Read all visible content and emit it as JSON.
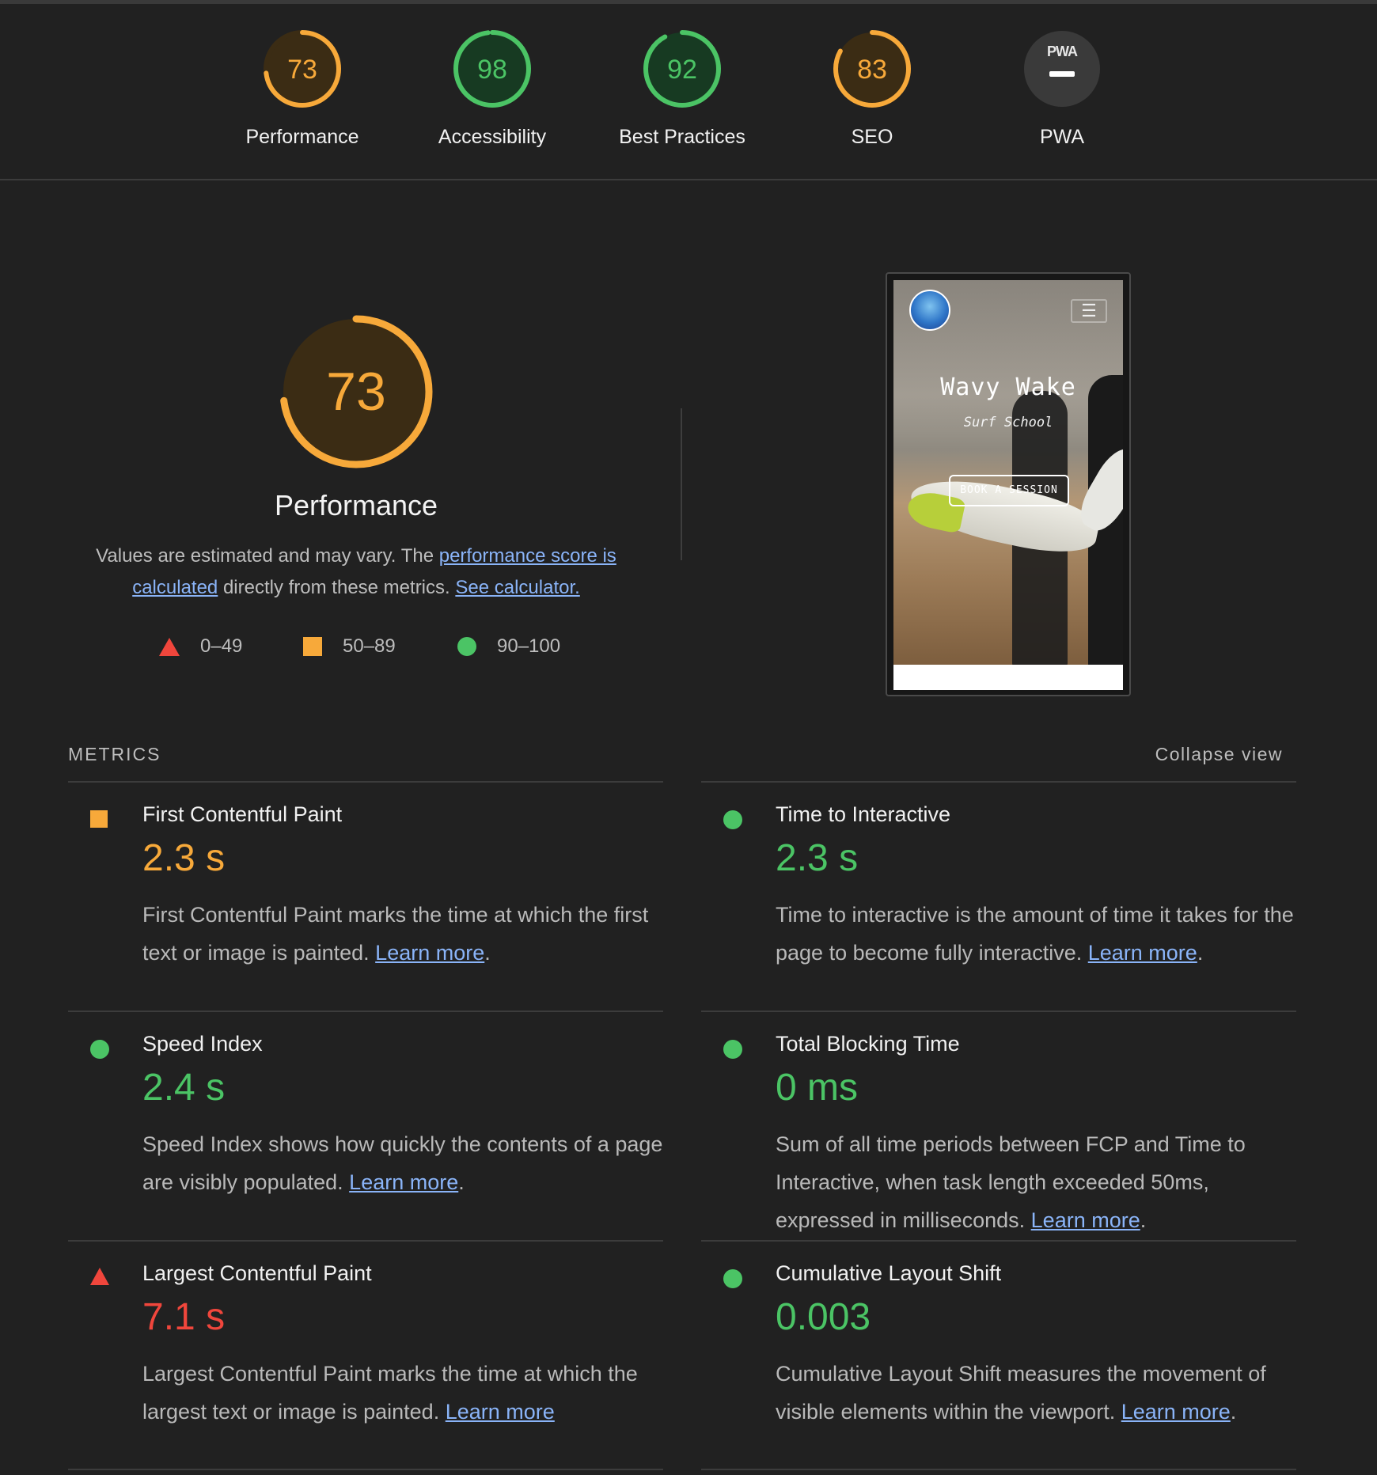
{
  "colors": {
    "background": "#212121",
    "fail": "#f0463c",
    "average": "#f7a93a",
    "pass": "#4bc465",
    "link": "#8ab4f8",
    "gauge_track_average": "#3b2c14",
    "gauge_track_pass": "#173a22",
    "pwa_circle": "#3a3a3a"
  },
  "categories": [
    {
      "label": "Performance",
      "score": "73",
      "value": 73,
      "rating": "average"
    },
    {
      "label": "Accessibility",
      "score": "98",
      "value": 98,
      "rating": "pass"
    },
    {
      "label": "Best Practices",
      "score": "92",
      "value": 92,
      "rating": "pass"
    },
    {
      "label": "SEO",
      "score": "83",
      "value": 83,
      "rating": "average"
    },
    {
      "label": "PWA",
      "badge": "PWA",
      "score": "—",
      "rating": "na"
    }
  ],
  "performance": {
    "score": "73",
    "value": 73,
    "title": "Performance",
    "desc_prefix": "Values are estimated and may vary. The ",
    "desc_link1": "performance score is calculated",
    "desc_middle": " directly from these metrics. ",
    "desc_link2": "See calculator."
  },
  "legend": [
    {
      "shape": "triangle",
      "range": "0–49"
    },
    {
      "shape": "square",
      "range": "50–89"
    },
    {
      "shape": "circle",
      "range": "90–100"
    }
  ],
  "thumbnail": {
    "brand": "Wavy Wake",
    "tagline": "Surf School",
    "cta": "BOOK A SESSION",
    "menu_icon": "hamburger-icon"
  },
  "metrics_section": {
    "heading": "METRICS",
    "collapse_label": "Collapse view"
  },
  "metrics": [
    {
      "title": "First Contentful Paint",
      "value": "2.3 s",
      "rating": "average",
      "desc": "First Contentful Paint marks the time at which the first text or image is painted.",
      "link": "Learn more",
      "suffix": "."
    },
    {
      "title": "Time to Interactive",
      "value": "2.3 s",
      "rating": "pass",
      "desc": "Time to interactive is the amount of time it takes for the page to become fully interactive.",
      "link": "Learn more",
      "suffix": "."
    },
    {
      "title": "Speed Index",
      "value": "2.4 s",
      "rating": "pass",
      "desc": "Speed Index shows how quickly the contents of a page are visibly populated.",
      "link": "Learn more",
      "suffix": "."
    },
    {
      "title": "Total Blocking Time",
      "value": "0 ms",
      "rating": "pass",
      "desc": "Sum of all time periods between FCP and Time to Interactive, when task length exceeded 50ms, expressed in milliseconds.",
      "link": "Learn more",
      "suffix": "."
    },
    {
      "title": "Largest Contentful Paint",
      "value": "7.1 s",
      "rating": "fail",
      "desc": "Largest Contentful Paint marks the time at which the largest text or image is painted.",
      "link": "Learn more",
      "suffix": ""
    },
    {
      "title": "Cumulative Layout Shift",
      "value": "0.003",
      "rating": "pass",
      "desc": "Cumulative Layout Shift measures the movement of visible elements within the viewport.",
      "link": "Learn more",
      "suffix": "."
    }
  ]
}
